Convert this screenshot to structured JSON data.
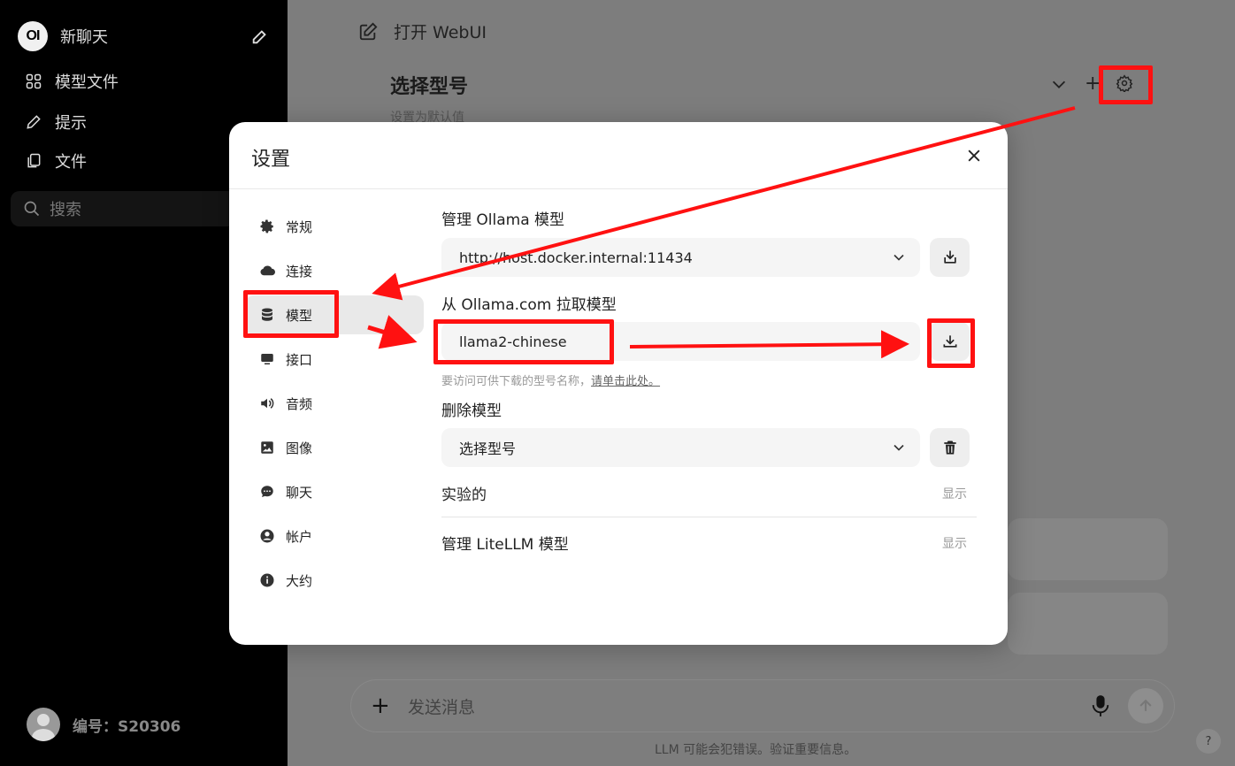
{
  "sidebar": {
    "logo_text": "OI",
    "new_chat": "新聊天",
    "items": [
      {
        "label": "模型文件",
        "icon": "grid-icon"
      },
      {
        "label": "提示",
        "icon": "pencil-icon"
      },
      {
        "label": "文件",
        "icon": "files-icon"
      }
    ],
    "search_placeholder": "搜索",
    "user_name": "编号：S20306"
  },
  "main": {
    "app_title": "打开 WebUI",
    "model_select_title": "选择型号",
    "set_default": "设置为默认值",
    "add_label": "+",
    "chat_placeholder": "发送消息",
    "footer_note": "LLM 可能会犯错误。验证重要信息。",
    "help_label": "?"
  },
  "modal": {
    "title": "设置",
    "nav": [
      {
        "label": "常规",
        "icon": "gear-icon"
      },
      {
        "label": "连接",
        "icon": "cloud-icon"
      },
      {
        "label": "模型",
        "icon": "database-icon",
        "active": true
      },
      {
        "label": "接口",
        "icon": "monitor-icon"
      },
      {
        "label": "音频",
        "icon": "speaker-icon"
      },
      {
        "label": "图像",
        "icon": "image-icon"
      },
      {
        "label": "聊天",
        "icon": "chat-bubble-icon"
      },
      {
        "label": "帐户",
        "icon": "account-icon"
      },
      {
        "label": "大约",
        "icon": "info-icon"
      }
    ],
    "manage_ollama_label": "管理 Ollama 模型",
    "ollama_url": "http://host.docker.internal:11434",
    "pull_label": "从 Ollama.com 拉取模型",
    "pull_value": "llama2-chinese",
    "hint_text": "要访问可供下载的型号名称，",
    "hint_link": "请单击此处。",
    "delete_label": "删除模型",
    "delete_select_value": "选择型号",
    "experimental_label": "实验的",
    "experimental_toggle": "显示",
    "litellm_label": "管理 LiteLLM 模型",
    "litellm_toggle": "显示"
  },
  "colors": {
    "annotation_red": "#ff1111",
    "sidebar_bg": "#000000",
    "overlay_bg": "#7d7d7d"
  }
}
